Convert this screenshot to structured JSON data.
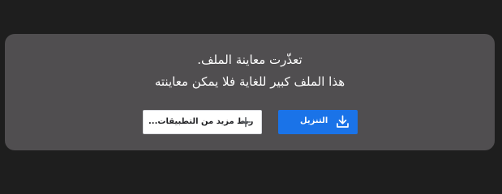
{
  "preview": {
    "title": "تعذّرت معاينة الملف.",
    "message": "هذا الملف كبير للغاية فلا يمكن معاينته"
  },
  "buttons": {
    "connect_apps_label": "ربط مزيد من التطبيقات...",
    "connect_apps_icon": "plus-icon",
    "download_label": "التنزيل",
    "download_icon": "download-icon"
  },
  "colors": {
    "page_background": "#1e1e1e",
    "card_background": "#504e50",
    "primary_button": "#1a73e8",
    "secondary_button": "#ffffff"
  }
}
